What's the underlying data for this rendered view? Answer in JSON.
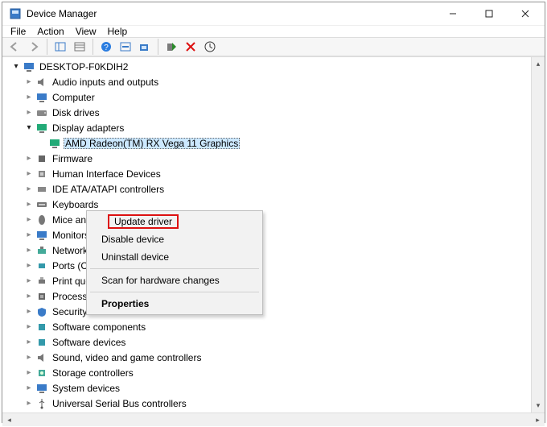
{
  "window": {
    "title": "Device Manager"
  },
  "menu": {
    "file": "File",
    "action": "Action",
    "view": "View",
    "help": "Help"
  },
  "tree": {
    "root": "DESKTOP-F0KDIH2",
    "display_adapters": "Display adapters",
    "selected_device": "AMD Radeon(TM) RX Vega 11 Graphics",
    "items": {
      "audio": "Audio inputs and outputs",
      "computer": "Computer",
      "disk": "Disk drives",
      "firmware": "Firmware",
      "hid": "Human Interface Devices",
      "ide": "IDE ATA/ATAPI controllers",
      "keyboards": "Keyboards",
      "mice": "Mice and other pointing devices",
      "monitors": "Monitors",
      "network": "Network adapters",
      "ports": "Ports (COM & LPT)",
      "printq": "Print queues",
      "processors": "Processors",
      "security": "Security devices",
      "swcomp": "Software components",
      "swdev": "Software devices",
      "sound": "Sound, video and game controllers",
      "storage": "Storage controllers",
      "sysdev": "System devices",
      "usb": "Universal Serial Bus controllers"
    }
  },
  "context_menu": {
    "update": "Update driver",
    "disable": "Disable device",
    "uninstall": "Uninstall device",
    "scan": "Scan for hardware changes",
    "properties": "Properties"
  }
}
